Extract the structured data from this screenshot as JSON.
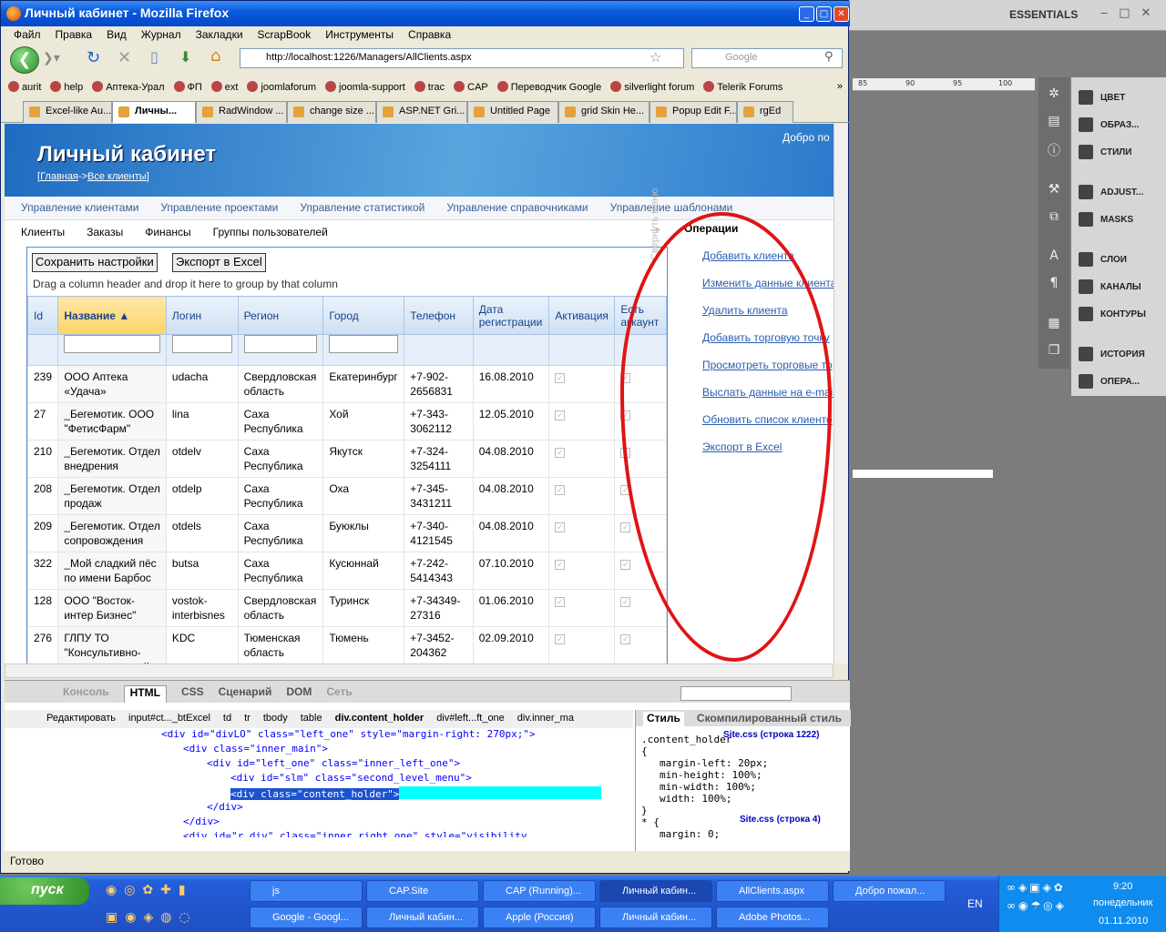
{
  "photoshop": {
    "workspace": "ESSENTIALS",
    "ruler_ticks": [
      "85",
      "90",
      "95",
      "100"
    ],
    "panels": [
      "ЦВЕТ",
      "ОБРАЗ...",
      "СТИЛИ",
      "ADJUST...",
      "MASKS",
      "СЛОИ",
      "КАНАЛЫ",
      "КОНТУРЫ",
      "ИСТОРИЯ",
      "ОПЕРА..."
    ]
  },
  "firefox": {
    "title": "Личный кабинет - Mozilla Firefox",
    "menu": [
      "Файл",
      "Правка",
      "Вид",
      "Журнал",
      "Закладки",
      "ScrapBook",
      "Инструменты",
      "Справка"
    ],
    "url": "http://localhost:1226/Managers/AllClients.aspx",
    "search_placeholder": "Google",
    "bookmarks": [
      "aurit",
      "help",
      "Аптека-Урал",
      "ФП",
      "ext",
      "joomlaforum",
      "joomla-support",
      "trac",
      "CAP",
      "Переводчик Google",
      "silverlight forum",
      "Telerik Forums"
    ],
    "tabs": [
      "Excel-like Au...",
      "Личны...",
      "RadWindow ...",
      "change size ...",
      "ASP.NET Gri...",
      "Untitled Page",
      "grid Skin He...",
      "Popup Edit F...",
      "rgEd"
    ],
    "status": "Готово"
  },
  "page": {
    "title": "Личный кабинет",
    "breadcrumb_home": "Главная",
    "breadcrumb_sep": "->",
    "breadcrumb_current": "Все клиенты",
    "welcome": "Добро по",
    "top_menu": [
      "Управление клиентами",
      "Управление проектами",
      "Управление статистикой",
      "Управление справочниками",
      "Управление шаблонами"
    ],
    "sub_menu": [
      "Клиенты",
      "Заказы",
      "Финансы",
      "Группы пользователей"
    ],
    "save_settings": "Сохранить настройки",
    "export_excel": "Экспорт в Excel",
    "group_hint": "Drag a column header and drop it here to group by that column",
    "collapse_label": "Свернуть меню",
    "columns": [
      "Id",
      "Название",
      "Логин",
      "Регион",
      "Город",
      "Телефон",
      "Дата регистрации",
      "Активация",
      "Есть аккаунт"
    ],
    "rows": [
      {
        "id": "239",
        "name": "ООО Аптека «Удача»",
        "login": "udacha",
        "region": "Свердловская область",
        "city": "Екатеринбург",
        "phone": "+7-902-2656831",
        "date": "16.08.2010"
      },
      {
        "id": "27",
        "name": "_Бегемотик. ООО \"ФетисФарм\"",
        "login": "lina",
        "region": "Саха Республика",
        "city": "Хой",
        "phone": "+7-343-3062112",
        "date": "12.05.2010"
      },
      {
        "id": "210",
        "name": "_Бегемотик. Отдел внедрения",
        "login": "otdelv",
        "region": "Саха Республика",
        "city": "Якутск",
        "phone": "+7-324-3254111",
        "date": "04.08.2010"
      },
      {
        "id": "208",
        "name": "_Бегемотик. Отдел продаж",
        "login": "otdelp",
        "region": "Саха Республика",
        "city": "Оха",
        "phone": "+7-345-3431211",
        "date": "04.08.2010"
      },
      {
        "id": "209",
        "name": "_Бегемотик. Отдел сопровождения",
        "login": "otdels",
        "region": "Саха Республика",
        "city": "Буюклы",
        "phone": "+7-340-4121545",
        "date": "04.08.2010"
      },
      {
        "id": "322",
        "name": "_Мой сладкий пёс по имени Барбос",
        "login": "butsa",
        "region": "Саха Республика",
        "city": "Кусюннай",
        "phone": "+7-242-5414343",
        "date": "07.10.2010"
      },
      {
        "id": "128",
        "name": "ООО \"Восток-интер Бизнес\"",
        "login": "vostok-interbisnes",
        "region": "Свердловская область",
        "city": "Туринск",
        "phone": "+7-34349-27316",
        "date": "01.06.2010"
      },
      {
        "id": "276",
        "name": "ГЛПУ ТО \"Консультивно-диагностический",
        "login": "KDC",
        "region": "Тюменская область",
        "city": "Тюмень",
        "phone": "+7-3452-204362",
        "date": "02.09.2010"
      }
    ],
    "operations_title": "Операции",
    "operations": [
      "Добавить клиента",
      "Изменить данные клиента",
      "Удалить клиента",
      "Добавить торговую точку",
      "Просмотреть торговые то",
      "Выслать данные на e-mail",
      "Обновить список клиенто",
      "Экспорт в Excel"
    ]
  },
  "firebug": {
    "tabs": [
      "Консоль",
      "HTML",
      "CSS",
      "Сценарий",
      "DOM",
      "Сеть"
    ],
    "edit": "Редактировать",
    "path": [
      "input#ct..._btExcel",
      "td",
      "tr",
      "tbody",
      "table",
      "div.content_holder",
      "div#left...ft_one",
      "div.inner_ma"
    ],
    "html_lines": [
      "<div id=\"divLO\" class=\"left_one\" style=\"margin-right: 270px;\">",
      "<div class=\"inner_main\">",
      "<div id=\"left_one\" class=\"inner_left_one\">",
      "<div id=\"slm\" class=\"second_level_menu\">",
      "<div class=\"content_holder\">",
      "</div>",
      "</div>",
      "<div id=\"r_div\" class=\"inner_right_one\" style=\"visibility"
    ],
    "style_tab": "Стиль",
    "computed_tab": "Скомпилированный стиль",
    "css_selector": ".content_holder",
    "css_source": "Site.css (строка 1222)",
    "css_props": [
      "margin-left: 20px;",
      "min-height: 100%;",
      "min-width: 100%;",
      "width: 100%;"
    ],
    "css_selector2": "* {",
    "css_source2": "Site.css (строка 4)",
    "css_prop2": "margin: 0;"
  },
  "taskbar": {
    "start": "пуск",
    "row1": [
      "js",
      "CAP.Site",
      "CAP (Running)...",
      "Личный кабин...",
      "AllClients.aspx",
      "Добро пожал..."
    ],
    "row2": [
      "Google - Googl...",
      "Личный кабин...",
      "Apple (Россия)",
      "Личный кабин...",
      "Adobe Photos..."
    ],
    "lang": "EN",
    "time": "9:20",
    "day": "понедельник",
    "date": "01.11.2010"
  }
}
